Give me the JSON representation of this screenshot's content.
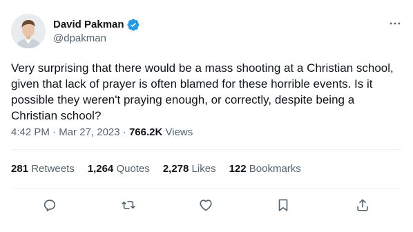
{
  "author": {
    "display_name": "David Pakman",
    "handle": "@dpakman",
    "verified": true,
    "verified_color": "#1d9bf0"
  },
  "tweet": {
    "text": "Very surprising that there would be a mass shooting at a Christian school, given that lack of prayer is often blamed for these horrible events. Is it possible they weren't praying enough, or correctly, despite being a Christian school?",
    "time": "4:42 PM",
    "date": "Mar 27, 2023",
    "views_count": "766.2K",
    "views_label": "Views",
    "separator": "·"
  },
  "stats": {
    "retweets": {
      "count": "281",
      "label": "Retweets"
    },
    "quotes": {
      "count": "1,264",
      "label": "Quotes"
    },
    "likes": {
      "count": "2,278",
      "label": "Likes"
    },
    "bookmarks": {
      "count": "122",
      "label": "Bookmarks"
    }
  },
  "actions": [
    "reply-icon",
    "retweet-icon",
    "like-icon",
    "bookmark-icon",
    "share-icon"
  ],
  "colors": {
    "text_primary": "#0f1419",
    "text_secondary": "#536471",
    "divider": "#eff3f4"
  }
}
